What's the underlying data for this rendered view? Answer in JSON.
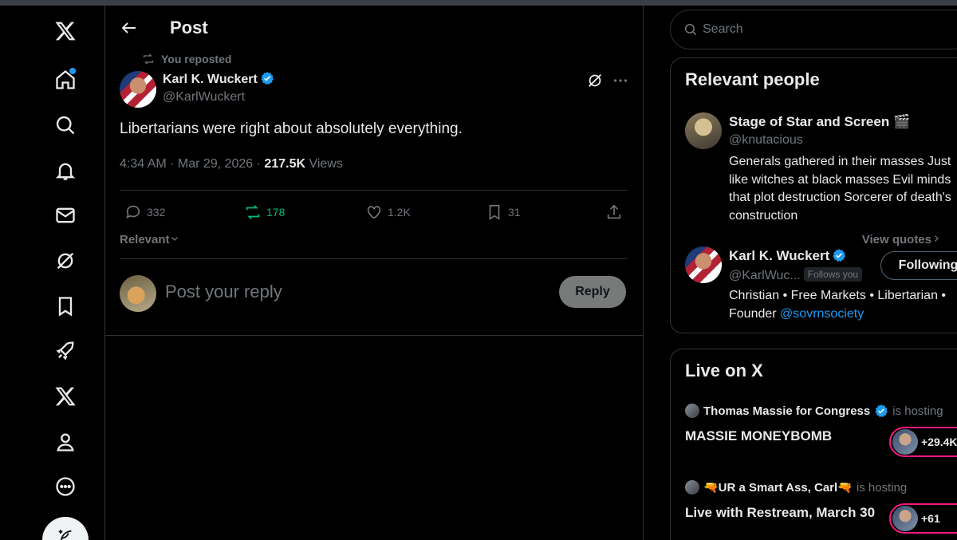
{
  "header": {
    "title": "Post"
  },
  "nav": {
    "items": [
      "x-logo-icon",
      "home-icon",
      "explore-icon",
      "notifications-icon",
      "messages-icon",
      "grok-icon",
      "bookmarks-icon",
      "rocket-icon",
      "premium-x-icon",
      "profile-icon",
      "more-icon"
    ],
    "compose_icon": "compose-feather-icon"
  },
  "post": {
    "reposted_label": "You reposted",
    "author_name": "Karl K. Wuckert",
    "author_handle": "@KarlWuckert",
    "body": "Libertarians were right about absolutely everything.",
    "timestamp": "4:34 AM · Mar 29, 2026 · ",
    "views_count": "217.5K",
    "views_label": " Views",
    "stats": {
      "replies": "332",
      "reposts": "178",
      "likes": "1.2K",
      "bookmarks": "31"
    },
    "sort_label": "Relevant",
    "view_quotes": "View quotes",
    "reply_placeholder": "Post your reply",
    "reply_button": "Reply"
  },
  "search": {
    "placeholder": "Search"
  },
  "relevant_people": {
    "title": "Relevant people",
    "people": [
      {
        "name": "Stage of Star and Screen 🎬",
        "handle": "@knutacious",
        "bio": "Generals gathered in their masses Just like witches at black masses Evil minds that plot destruction Sorcerer of death's construction"
      },
      {
        "name": "Karl K. Wuckert",
        "handle": "@KarlWuc...",
        "follows_you": "Follows you",
        "bio_prefix": "Christian • Free Markets • Libertarian • Founder ",
        "bio_link": "@sovrnsociety",
        "button": "Following"
      }
    ]
  },
  "live": {
    "title": "Live on X",
    "spaces": [
      {
        "host": "Thomas Massie for Congress",
        "hosting": "is hosting",
        "title": "MASSIE MONEYBOMB",
        "listeners": "+29.4K"
      },
      {
        "host": "🔫UR a Smart Ass, Carl🔫",
        "hosting": "is hosting",
        "title": "Live with Restream, March 30",
        "listeners": "+61"
      }
    ]
  },
  "colors": {
    "accent": "#1d9bf0",
    "repost_green": "#00ba7c",
    "live_pink": "#f91880",
    "muted": "#71767b"
  }
}
